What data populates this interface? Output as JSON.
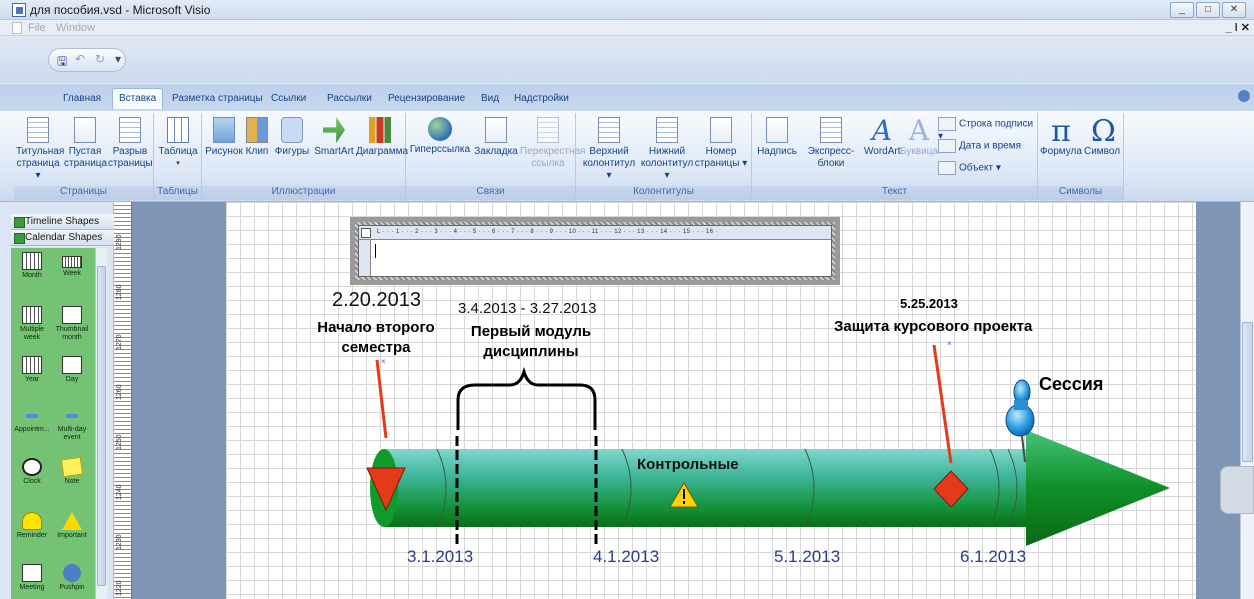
{
  "window": {
    "title": "для пособия.vsd - Microsoft Visio",
    "controls": [
      "_",
      "□",
      "✕"
    ]
  },
  "menubar": {
    "items": [
      "File",
      "Window"
    ],
    "mdi_controls": "_ ǀ ✕"
  },
  "qat": {
    "save": "🖫",
    "undo": "↶",
    "redo": "↻",
    "customize": "▾"
  },
  "ribbon": {
    "tabs": [
      "Главная",
      "Вставка",
      "Разметка страницы",
      "Ссылки",
      "Рассылки",
      "Рецензирование",
      "Вид",
      "Надстройки"
    ],
    "active_tab": "Вставка",
    "groups": {
      "pages": {
        "label": "Страницы",
        "buttons": [
          {
            "line1": "Титульная",
            "line2": "страница ▾"
          },
          {
            "line1": "Пустая",
            "line2": "страница"
          },
          {
            "line1": "Разрыв",
            "line2": "страницы"
          }
        ]
      },
      "tables": {
        "label": "Таблицы",
        "buttons": [
          {
            "line1": "Таблица",
            "line2": "▾"
          }
        ]
      },
      "illustrations": {
        "label": "Иллюстрации",
        "buttons": [
          "Рисунок",
          "Клип",
          "Фигуры",
          "SmartArt",
          "Диаграмма"
        ]
      },
      "links": {
        "label": "Связи",
        "buttons": [
          "Гиперссылка",
          "Закладка",
          "Перекрестная",
          "ссылка"
        ]
      },
      "headers": {
        "label": "Колонтитулы",
        "buttons": [
          {
            "line1": "Верхний",
            "line2": "колонтитул ▾"
          },
          {
            "line1": "Нижний",
            "line2": "колонтитул ▾"
          },
          {
            "line1": "Номер",
            "line2": "страницы ▾"
          }
        ]
      },
      "text": {
        "label": "Текст",
        "buttons": [
          "Надпись",
          "Экспресс-блоки",
          "WordArt",
          "Буквица"
        ],
        "small": [
          "Строка подписи ▾",
          "Дата и время",
          "Объект ▾"
        ]
      },
      "symbols": {
        "label": "Символы",
        "buttons": [
          "Формула",
          "Символ"
        ]
      }
    }
  },
  "stencils": {
    "headers": [
      "Timeline Shapes",
      "Calendar Shapes"
    ],
    "shapes": [
      {
        "label": "Month",
        "icon": "calendar-month-icon"
      },
      {
        "label": "Week",
        "icon": "calendar-week-icon"
      },
      {
        "label": "Multiple week",
        "icon": "calendar-multiweek-icon"
      },
      {
        "label": "Thumbnail month",
        "icon": "thumbnail-month-icon"
      },
      {
        "label": "Year",
        "icon": "calendar-year-icon"
      },
      {
        "label": "Day",
        "icon": "calendar-day-icon"
      },
      {
        "label": "Appointm...",
        "icon": "appointment-icon"
      },
      {
        "label": "Multi-day event",
        "icon": "multiday-event-icon"
      },
      {
        "label": "Clock",
        "icon": "clock-icon"
      },
      {
        "label": "Note",
        "icon": "note-icon"
      },
      {
        "label": "Reminder",
        "icon": "reminder-bell-icon"
      },
      {
        "label": "Important",
        "icon": "warning-icon"
      },
      {
        "label": "Meeting",
        "icon": "meeting-icon"
      },
      {
        "label": "Pushpin",
        "icon": "pushpin-icon"
      }
    ]
  },
  "ruler": {
    "vertical_labels": [
      "1290",
      "1280",
      "1270",
      "1260",
      "1250",
      "1240",
      "1230",
      "1220"
    ],
    "horizontal_marks": "L · · · 1 · · · 2 · · · 3 · · · 4 · · · 5 · · · 6 · · · 7 · · · 8 · · · 9 · · · 10 · · · 11 · · · 12 · · · 13 · · · 14 · · · 15 · · · 16 ·"
  },
  "timeline": {
    "start_date": "2.20.2013",
    "start_label_1": "Начало второго",
    "start_label_2": "семестра",
    "range_dates": "3.4.2013 - 3.27.2013",
    "range_label_1": "Первый модуль",
    "range_label_2": "дисциплины",
    "milestone_date": "5.25.2013",
    "milestone_label": "Защита курсового проекта",
    "session_label": "Сессия",
    "control_label": "Контрольные",
    "ticks": [
      "3.1.2013",
      "4.1.2013",
      "5.1.2013",
      "6.1.2013"
    ],
    "colors": {
      "bar_top": "#6fd2c8",
      "bar_bottom": "#0e7a1a",
      "arrow": "#0e8a1c",
      "start_marker": "#e53a1a",
      "milestone": "#e53a1a",
      "warning": "#ffd400"
    }
  }
}
